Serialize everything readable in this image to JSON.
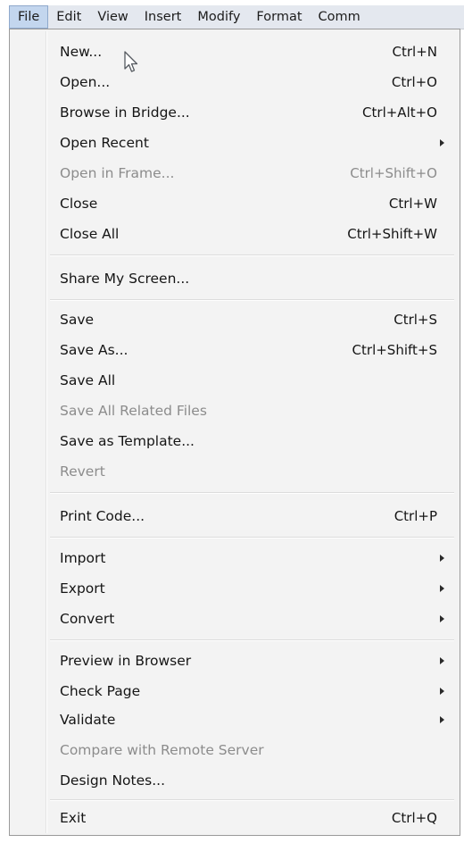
{
  "menubar": {
    "items": [
      {
        "label": "File",
        "active": true
      },
      {
        "label": "Edit"
      },
      {
        "label": "View"
      },
      {
        "label": "Insert"
      },
      {
        "label": "Modify"
      },
      {
        "label": "Format"
      },
      {
        "label": "Comm"
      }
    ]
  },
  "file_menu": {
    "items": [
      {
        "label": "New...",
        "shortcut": "Ctrl+N"
      },
      {
        "label": "Open...",
        "shortcut": "Ctrl+O"
      },
      {
        "label": "Browse in Bridge...",
        "shortcut": "Ctrl+Alt+O"
      },
      {
        "label": "Open Recent",
        "submenu": true
      },
      {
        "label": "Open in Frame...",
        "shortcut": "Ctrl+Shift+O",
        "disabled": true
      },
      {
        "label": "Close",
        "shortcut": "Ctrl+W"
      },
      {
        "label": "Close All",
        "shortcut": "Ctrl+Shift+W"
      },
      {
        "label": "Share My Screen..."
      },
      {
        "label": "Save",
        "shortcut": "Ctrl+S"
      },
      {
        "label": "Save As...",
        "shortcut": "Ctrl+Shift+S"
      },
      {
        "label": "Save All"
      },
      {
        "label": "Save All Related Files",
        "disabled": true
      },
      {
        "label": "Save as Template..."
      },
      {
        "label": "Revert",
        "disabled": true
      },
      {
        "label": "Print Code...",
        "shortcut": "Ctrl+P"
      },
      {
        "label": "Import",
        "submenu": true
      },
      {
        "label": "Export",
        "submenu": true
      },
      {
        "label": "Convert",
        "submenu": true
      },
      {
        "label": "Preview in Browser",
        "submenu": true
      },
      {
        "label": "Check Page",
        "submenu": true
      },
      {
        "label": "Validate",
        "submenu": true
      },
      {
        "label": "Compare with Remote Server",
        "disabled": true
      },
      {
        "label": "Design Notes..."
      },
      {
        "label": "Exit",
        "shortcut": "Ctrl+Q"
      }
    ]
  },
  "icons": {
    "cursor": "mouse-pointer-icon",
    "submenu": "submenu-arrow-icon"
  },
  "colors": {
    "menu_background": "#f3f3f3",
    "menubar_background": "#e4e8ef",
    "active_menubar_item": "#c3d6ee",
    "disabled_text": "#8c8c8c"
  }
}
